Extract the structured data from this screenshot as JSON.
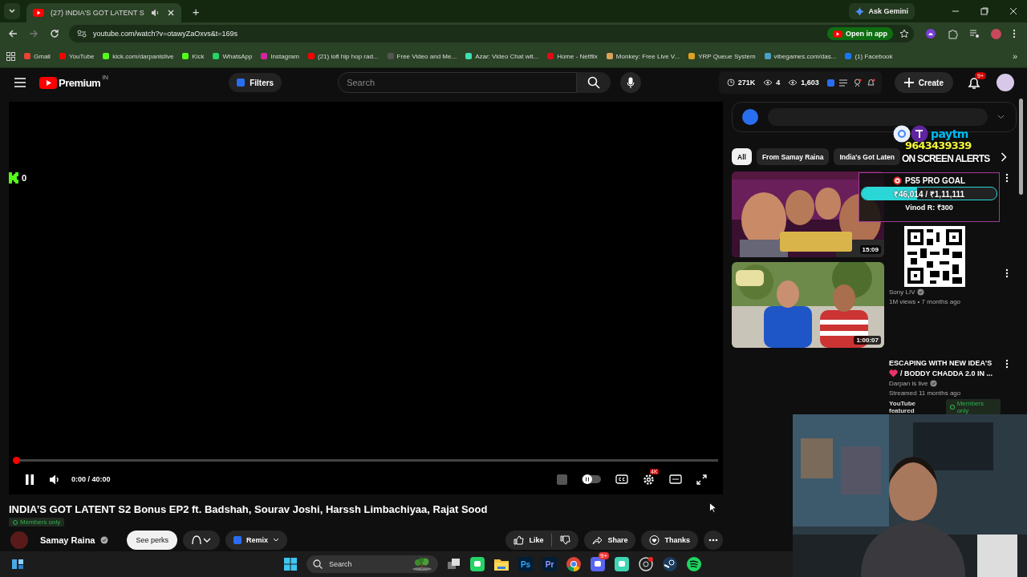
{
  "browser": {
    "tab": {
      "title": "(27) INDIA'S GOT LATENT S",
      "audio": true
    },
    "new_tab": "+",
    "ask_gemini": "Ask Gemini",
    "url": "youtube.com/watch?v=otawyZaOxvs&t=169s",
    "open_in_app": "Open in app",
    "bookmarks": [
      {
        "label": "Gmail",
        "color": "#ea4335"
      },
      {
        "label": "YouTube",
        "color": "#ff0000"
      },
      {
        "label": "kick.com/darpanislive",
        "color": "#53fc18"
      },
      {
        "label": "Kick",
        "color": "#53fc18"
      },
      {
        "label": "WhatsApp",
        "color": "#25d366"
      },
      {
        "label": "Instagram",
        "color": "#d6249f"
      },
      {
        "label": "(21) lofi hip hop rad...",
        "color": "#ff0000"
      },
      {
        "label": "Free Video and Me...",
        "color": "#555555"
      },
      {
        "label": "Azar: Video Chat wit...",
        "color": "#3ee0b0"
      },
      {
        "label": "Home - Netflix",
        "color": "#e50914"
      },
      {
        "label": "Monkey: Free Live V...",
        "color": "#d9a35b"
      },
      {
        "label": "YRP Queue System",
        "color": "#e0a020"
      },
      {
        "label": "vibegames.com/das...",
        "color": "#4aa0c8"
      },
      {
        "label": "(1) Facebook",
        "color": "#1877f2"
      }
    ],
    "more": "»"
  },
  "youtube": {
    "logo": "Premium",
    "region": "IN",
    "filters": "Filters",
    "search_placeholder": "Search",
    "stats": [
      "271K",
      "4",
      "1,603"
    ],
    "create": "Create",
    "notifications": "9+"
  },
  "player": {
    "kick_count": "0",
    "playing": true,
    "level": 0,
    "time": "0:00 / 40:00",
    "settings_badge": "4K"
  },
  "video": {
    "title": "INDIA’S GOT LATENT S2 Bonus EP2 ft. Badshah, Sourav Joshi, Harssh Limbachiyaa, Rajat Sood",
    "badge": "Members only",
    "channel": "Samay Raina",
    "perks": "See perks",
    "remix": "Remix",
    "like": "Like",
    "share": "Share",
    "thanks": "Thanks"
  },
  "sidebar": {
    "chips": [
      {
        "label": "All",
        "selected": true
      },
      {
        "label": "From Samay Raina",
        "selected": false
      },
      {
        "label": "India's Got Laten",
        "selected": false
      }
    ],
    "videos": [
      {
        "duration": "15:09",
        "kind": "picture"
      },
      {
        "duration": "1:00:07",
        "kind": "picture",
        "channel": "Sony LIV",
        "meta": "1M views • 7 months ago"
      },
      {
        "title": "ESCAPING WITH NEW IDEA'S",
        "title_line2": "/ BODDY CHADDA 2.0 IN ...",
        "channel": "Darpan is live",
        "meta": "Streamed 11 months ago",
        "featured": "YouTube featured",
        "badge": "Members only"
      }
    ]
  },
  "overlay": {
    "paytm": "paytm",
    "phone": "9643439339",
    "alerts": "ON SCREEN ALERTS",
    "goal_title": "PS5 PRO GOAL",
    "goal_amount": "₹46,014 / ₹1,11,111",
    "level": 0.41,
    "donation": "Vinod R: ₹300"
  },
  "taskbar": {
    "search": "Search",
    "apps": [
      {
        "kind": "windows"
      },
      {
        "kind": "search"
      },
      {
        "kind": "taskview"
      },
      {
        "kind": "tile",
        "color": "#25d366"
      },
      {
        "kind": "folder"
      },
      {
        "kind": "text",
        "label": "Ps",
        "color": "#31a8ff"
      },
      {
        "kind": "text",
        "label": "Pr",
        "color": "#9999ff"
      },
      {
        "kind": "chrome"
      },
      {
        "kind": "tile",
        "color": "#5865f2",
        "badge": "9+"
      },
      {
        "kind": "tile",
        "color": "#3ed6b4"
      },
      {
        "kind": "ring"
      },
      {
        "kind": "ring2"
      },
      {
        "kind": "spotify"
      }
    ]
  }
}
